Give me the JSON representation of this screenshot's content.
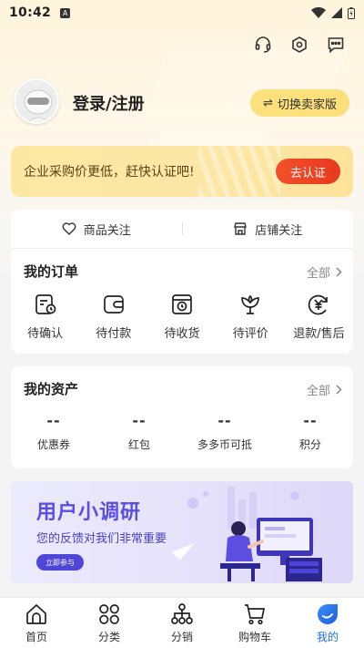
{
  "status_bar": {
    "time": "10:42",
    "sim_label": "A"
  },
  "header": {
    "icons": [
      "headset-icon",
      "settings-icon",
      "message-icon"
    ]
  },
  "profile": {
    "login_text": "登录/注册",
    "switch_label": "切换卖家版"
  },
  "enterprise_banner": {
    "text": "企业采购价更低，赶快认证吧!",
    "button": "去认证"
  },
  "follow": {
    "goods": "商品关注",
    "shop": "店铺关注"
  },
  "orders": {
    "title": "我的订单",
    "all": "全部",
    "items": [
      {
        "label": "待确认",
        "icon": "pending-confirm-icon"
      },
      {
        "label": "待付款",
        "icon": "wallet-icon"
      },
      {
        "label": "待收货",
        "icon": "delivery-box-icon"
      },
      {
        "label": "待评价",
        "icon": "flower-review-icon"
      },
      {
        "label": "退款/售后",
        "icon": "refund-yen-icon"
      }
    ]
  },
  "assets": {
    "title": "我的资产",
    "all": "全部",
    "items": [
      {
        "value": "--",
        "label": "优惠券"
      },
      {
        "value": "--",
        "label": "红包"
      },
      {
        "value": "--",
        "label": "多多币可抵"
      },
      {
        "value": "--",
        "label": "积分"
      }
    ]
  },
  "survey_banner": {
    "title": "用户小调研",
    "subtitle": "您的反馈对我们非常重要",
    "cta": "立即参与"
  },
  "tabbar": {
    "items": [
      {
        "label": "首页",
        "icon": "home-icon"
      },
      {
        "label": "分类",
        "icon": "category-icon"
      },
      {
        "label": "分销",
        "icon": "distribution-icon"
      },
      {
        "label": "购物车",
        "icon": "cart-icon"
      },
      {
        "label": "我的",
        "icon": "profile-icon"
      }
    ],
    "active_index": 4
  },
  "colors": {
    "accent_orange": "#e8381d",
    "accent_yellow": "#fbe07b",
    "active_blue": "#1f6fe0",
    "survey_purple": "#5b4ee0"
  }
}
